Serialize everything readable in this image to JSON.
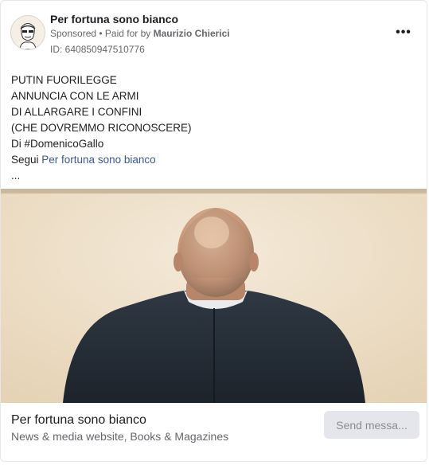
{
  "post": {
    "page_name": "Per fortuna sono bianco",
    "sponsored_label": "Sponsored",
    "separator": " • ",
    "paid_for_prefix": "Paid for by ",
    "paid_for_name": "Maurizio Chierici",
    "ad_id": "ID: 640850947510776",
    "more_label": "•••",
    "avatar_icon": "caricature-avatar-icon",
    "body_lines": [
      "PUTIN FUORILEGGE",
      "ANNUNCIA CON LE ARMI",
      "DI ALLARGARE I CONFINI",
      "(CHE DOVREMMO RICONOSCERE)",
      "Di #DomenicoGallo"
    ],
    "follow_prefix": "Segui ",
    "follow_link": "Per fortuna sono bianco",
    "ellipsis": "..."
  },
  "footer": {
    "title": "Per fortuna sono bianco",
    "subtitle": "News & media website, Books & Magazines",
    "cta_label": "Send messa..."
  },
  "colors": {
    "link": "#385898",
    "secondary_text": "#65676b",
    "button_bg": "#e4e6eb"
  }
}
